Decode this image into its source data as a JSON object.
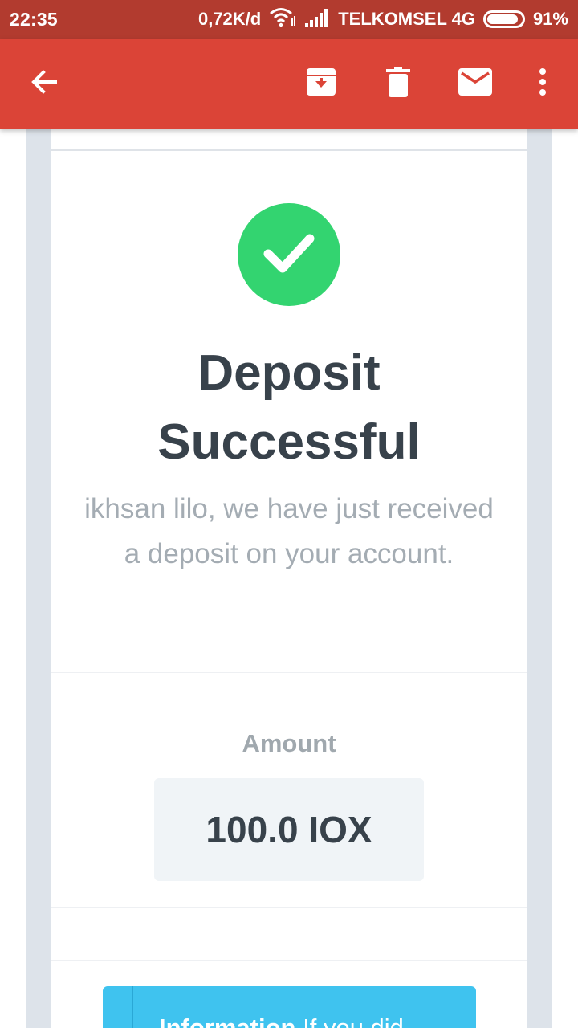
{
  "status_bar": {
    "time": "22:35",
    "speed": "0,72K/d",
    "carrier": "TELKOMSEL 4G",
    "battery_text": "91%",
    "battery_level": 0.91
  },
  "toolbar": {
    "back_icon": "arrow-left-icon",
    "archive_icon": "archive-icon",
    "delete_icon": "trash-icon",
    "mail_icon": "mail-icon",
    "more_icon": "more-vert-icon"
  },
  "email": {
    "title_line1": "Deposit",
    "title_line2": "Successful",
    "message": "ikhsan lilo, we have just received a deposit on your account.",
    "amount_label": "Amount",
    "amount_value": "100.0 IOX",
    "info_label": "Information",
    "info_text": "If you did"
  },
  "colors": {
    "status_bar": "#b23b2f",
    "app_bar": "#db4437",
    "success_green": "#33d470",
    "info_blue": "#3fc3ef",
    "heading": "#38424b"
  }
}
